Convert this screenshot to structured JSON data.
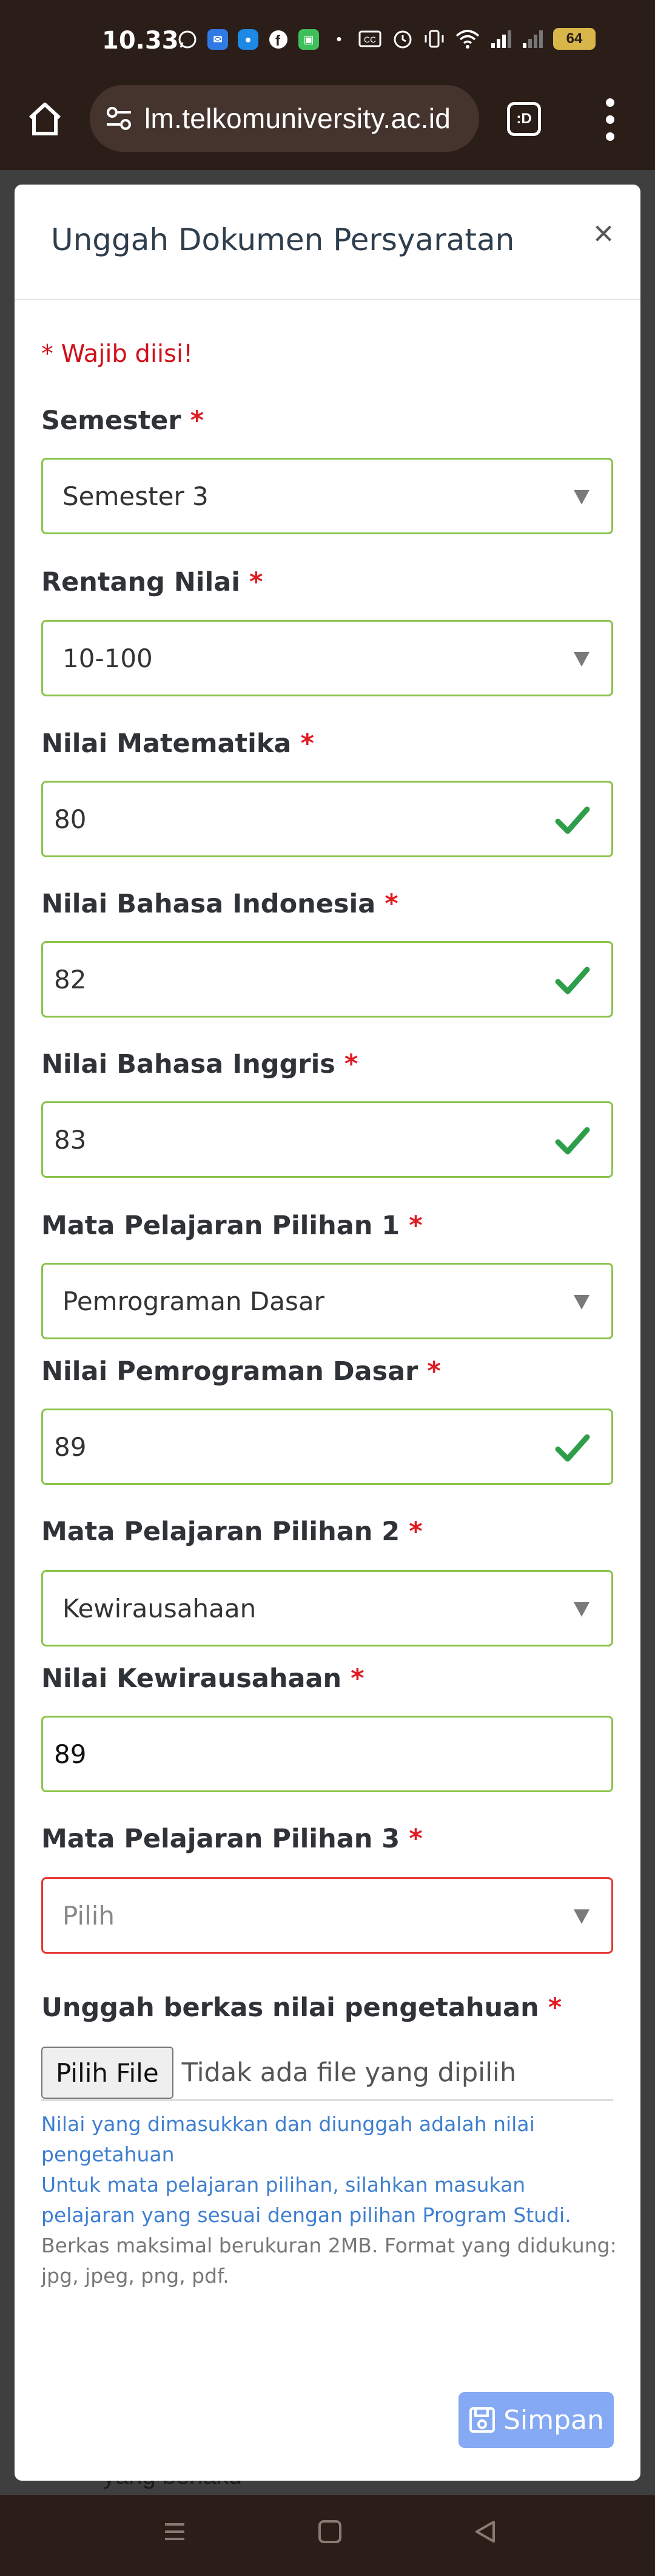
{
  "status_bar": {
    "time": "10.33",
    "battery": "64",
    "icons": [
      "whatsapp-icon",
      "mail-app-icon",
      "messenger-icon",
      "facebook-icon",
      "app-icon",
      "dot-icon",
      "cast-icon",
      "alarm-icon",
      "vibrate-icon",
      "wifi-icon",
      "signal-icon",
      "signal-icon-2",
      "battery-icon"
    ]
  },
  "browser": {
    "url": "lm.telkomuniversity.ac.id",
    "tab_badge": ":D"
  },
  "modal": {
    "title": "Unggah Dokumen Persyaratan",
    "close": "×",
    "required_note": "* Wajib diisi!",
    "fields": [
      {
        "label": "Semester",
        "required": "*",
        "type": "select",
        "value": "Semester 3",
        "state": "valid"
      },
      {
        "label": "Rentang Nilai",
        "required": "*",
        "type": "select",
        "value": "10-100",
        "state": "valid"
      },
      {
        "label": "Nilai Matematika",
        "required": "*",
        "type": "input",
        "value": "80",
        "state": "valid"
      },
      {
        "label": "Nilai Bahasa Indonesia",
        "required": "*",
        "type": "input",
        "value": "82",
        "state": "valid"
      },
      {
        "label": "Nilai Bahasa Inggris",
        "required": "*",
        "type": "input",
        "value": "83",
        "state": "valid"
      },
      {
        "label": "Mata Pelajaran Pilihan 1",
        "required": "*",
        "type": "select",
        "value": "Pemrograman Dasar",
        "state": "valid"
      },
      {
        "label": "Nilai Pemrograman Dasar",
        "required": "*",
        "type": "input",
        "value": "89",
        "state": "valid"
      },
      {
        "label": "Mata Pelajaran Pilihan 2",
        "required": "*",
        "type": "select",
        "value": "Kewirausahaan",
        "state": "valid"
      },
      {
        "label": "Nilai Kewirausahaan",
        "required": "*",
        "type": "input",
        "value": "89",
        "state": "editing"
      },
      {
        "label": "Mata Pelajaran Pilihan 3",
        "required": "*",
        "type": "select",
        "value": "Pilih",
        "state": "invalid"
      }
    ],
    "upload": {
      "label": "Unggah berkas nilai pengetahuan",
      "required": "*",
      "button": "Pilih File",
      "status": "Tidak ada file yang dipilih"
    },
    "help_blue": [
      "Nilai yang dimasukkan dan diunggah adalah nilai pengetahuan",
      "Untuk mata pelajaran pilihan, silahkan masukan pelajaran yang sesuai dengan pilihan Program Studi."
    ],
    "help_gray": "Berkas maksimal berukuran 2MB. Format yang didukung: jpg, jpeg, png, pdf.",
    "save_button": "Simpan"
  },
  "backdrop": {
    "bottom_text": "yang berlaku"
  },
  "colors": {
    "valid_border": "#8bc34a",
    "invalid_border": "#e53935",
    "check": "#2e9e4a",
    "required": "#e01b24",
    "help_blue": "#3f7fd0",
    "save_button": "#85a9f2"
  }
}
